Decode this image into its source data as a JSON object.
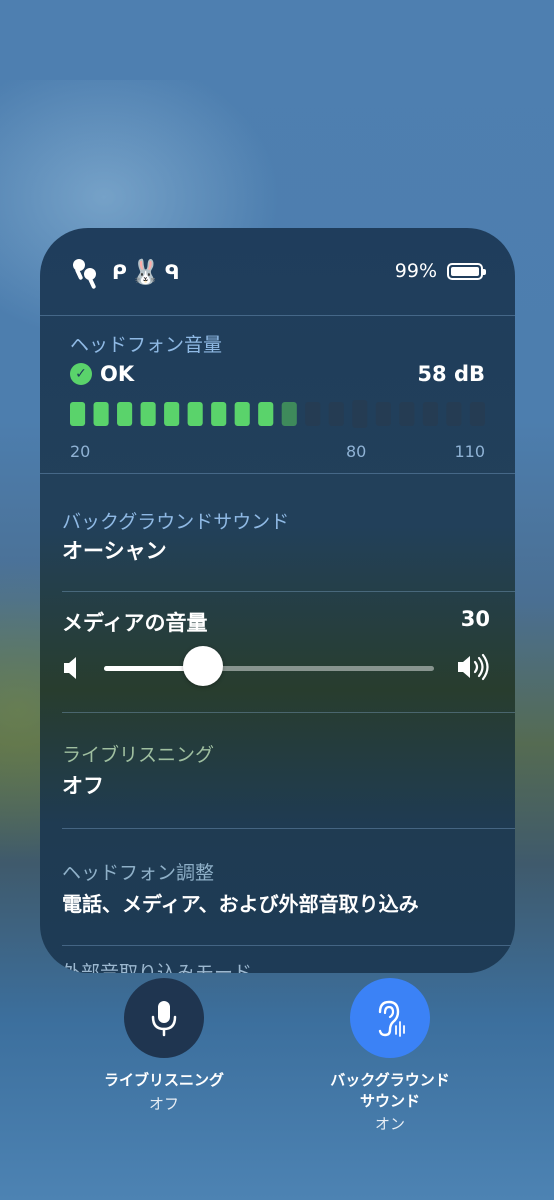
{
  "status": {
    "battery_percent": "99%",
    "device_emojis": [
      "🐰"
    ],
    "battery_level": 0.99
  },
  "headphone_volume": {
    "label": "ヘッドフォン音量",
    "status": "OK",
    "level": "58 dB",
    "ticks": [
      "20",
      "80",
      "110"
    ],
    "filled_segments": 9,
    "total_segments": 18
  },
  "background_sound": {
    "label": "バックグラウンドサウンド",
    "value": "オーシャン"
  },
  "media_volume": {
    "label": "メディアの音量",
    "value": "30",
    "level": 0.3
  },
  "live_listen": {
    "label": "ライブリスニング",
    "value": "オフ"
  },
  "headphone_adjust": {
    "label": "ヘッドフォン調整",
    "value": "電話、メディア、および外部音取り込み"
  },
  "transparency_mode": {
    "label": "外部音取り込みモード"
  },
  "bottom_controls": {
    "live_listen": {
      "label": "ライブリスニング",
      "sub": "オフ"
    },
    "background_sound": {
      "label_line1": "バックグラウンド",
      "label_line2": "サウンド",
      "sub": "オン"
    }
  },
  "colors": {
    "accent_green": "#5ad36b",
    "button_blue": "#3b82f6",
    "label_blue": "#8fb9e4"
  }
}
